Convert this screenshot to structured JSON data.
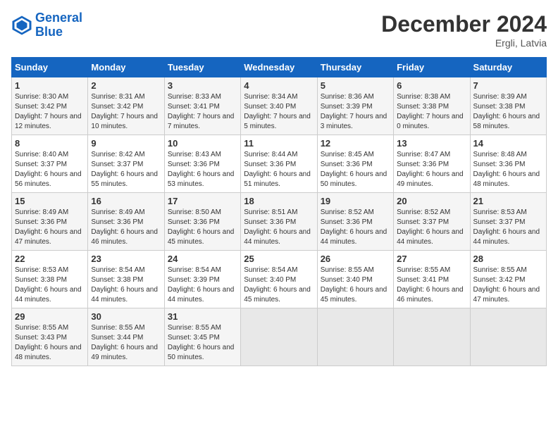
{
  "header": {
    "logo_line1": "General",
    "logo_line2": "Blue",
    "month": "December 2024",
    "location": "Ergli, Latvia"
  },
  "weekdays": [
    "Sunday",
    "Monday",
    "Tuesday",
    "Wednesday",
    "Thursday",
    "Friday",
    "Saturday"
  ],
  "weeks": [
    [
      {
        "day": "1",
        "sunrise": "Sunrise: 8:30 AM",
        "sunset": "Sunset: 3:42 PM",
        "daylight": "Daylight: 7 hours and 12 minutes."
      },
      {
        "day": "2",
        "sunrise": "Sunrise: 8:31 AM",
        "sunset": "Sunset: 3:42 PM",
        "daylight": "Daylight: 7 hours and 10 minutes."
      },
      {
        "day": "3",
        "sunrise": "Sunrise: 8:33 AM",
        "sunset": "Sunset: 3:41 PM",
        "daylight": "Daylight: 7 hours and 7 minutes."
      },
      {
        "day": "4",
        "sunrise": "Sunrise: 8:34 AM",
        "sunset": "Sunset: 3:40 PM",
        "daylight": "Daylight: 7 hours and 5 minutes."
      },
      {
        "day": "5",
        "sunrise": "Sunrise: 8:36 AM",
        "sunset": "Sunset: 3:39 PM",
        "daylight": "Daylight: 7 hours and 3 minutes."
      },
      {
        "day": "6",
        "sunrise": "Sunrise: 8:38 AM",
        "sunset": "Sunset: 3:38 PM",
        "daylight": "Daylight: 7 hours and 0 minutes."
      },
      {
        "day": "7",
        "sunrise": "Sunrise: 8:39 AM",
        "sunset": "Sunset: 3:38 PM",
        "daylight": "Daylight: 6 hours and 58 minutes."
      }
    ],
    [
      {
        "day": "8",
        "sunrise": "Sunrise: 8:40 AM",
        "sunset": "Sunset: 3:37 PM",
        "daylight": "Daylight: 6 hours and 56 minutes."
      },
      {
        "day": "9",
        "sunrise": "Sunrise: 8:42 AM",
        "sunset": "Sunset: 3:37 PM",
        "daylight": "Daylight: 6 hours and 55 minutes."
      },
      {
        "day": "10",
        "sunrise": "Sunrise: 8:43 AM",
        "sunset": "Sunset: 3:36 PM",
        "daylight": "Daylight: 6 hours and 53 minutes."
      },
      {
        "day": "11",
        "sunrise": "Sunrise: 8:44 AM",
        "sunset": "Sunset: 3:36 PM",
        "daylight": "Daylight: 6 hours and 51 minutes."
      },
      {
        "day": "12",
        "sunrise": "Sunrise: 8:45 AM",
        "sunset": "Sunset: 3:36 PM",
        "daylight": "Daylight: 6 hours and 50 minutes."
      },
      {
        "day": "13",
        "sunrise": "Sunrise: 8:47 AM",
        "sunset": "Sunset: 3:36 PM",
        "daylight": "Daylight: 6 hours and 49 minutes."
      },
      {
        "day": "14",
        "sunrise": "Sunrise: 8:48 AM",
        "sunset": "Sunset: 3:36 PM",
        "daylight": "Daylight: 6 hours and 48 minutes."
      }
    ],
    [
      {
        "day": "15",
        "sunrise": "Sunrise: 8:49 AM",
        "sunset": "Sunset: 3:36 PM",
        "daylight": "Daylight: 6 hours and 47 minutes."
      },
      {
        "day": "16",
        "sunrise": "Sunrise: 8:49 AM",
        "sunset": "Sunset: 3:36 PM",
        "daylight": "Daylight: 6 hours and 46 minutes."
      },
      {
        "day": "17",
        "sunrise": "Sunrise: 8:50 AM",
        "sunset": "Sunset: 3:36 PM",
        "daylight": "Daylight: 6 hours and 45 minutes."
      },
      {
        "day": "18",
        "sunrise": "Sunrise: 8:51 AM",
        "sunset": "Sunset: 3:36 PM",
        "daylight": "Daylight: 6 hours and 44 minutes."
      },
      {
        "day": "19",
        "sunrise": "Sunrise: 8:52 AM",
        "sunset": "Sunset: 3:36 PM",
        "daylight": "Daylight: 6 hours and 44 minutes."
      },
      {
        "day": "20",
        "sunrise": "Sunrise: 8:52 AM",
        "sunset": "Sunset: 3:37 PM",
        "daylight": "Daylight: 6 hours and 44 minutes."
      },
      {
        "day": "21",
        "sunrise": "Sunrise: 8:53 AM",
        "sunset": "Sunset: 3:37 PM",
        "daylight": "Daylight: 6 hours and 44 minutes."
      }
    ],
    [
      {
        "day": "22",
        "sunrise": "Sunrise: 8:53 AM",
        "sunset": "Sunset: 3:38 PM",
        "daylight": "Daylight: 6 hours and 44 minutes."
      },
      {
        "day": "23",
        "sunrise": "Sunrise: 8:54 AM",
        "sunset": "Sunset: 3:38 PM",
        "daylight": "Daylight: 6 hours and 44 minutes."
      },
      {
        "day": "24",
        "sunrise": "Sunrise: 8:54 AM",
        "sunset": "Sunset: 3:39 PM",
        "daylight": "Daylight: 6 hours and 44 minutes."
      },
      {
        "day": "25",
        "sunrise": "Sunrise: 8:54 AM",
        "sunset": "Sunset: 3:40 PM",
        "daylight": "Daylight: 6 hours and 45 minutes."
      },
      {
        "day": "26",
        "sunrise": "Sunrise: 8:55 AM",
        "sunset": "Sunset: 3:40 PM",
        "daylight": "Daylight: 6 hours and 45 minutes."
      },
      {
        "day": "27",
        "sunrise": "Sunrise: 8:55 AM",
        "sunset": "Sunset: 3:41 PM",
        "daylight": "Daylight: 6 hours and 46 minutes."
      },
      {
        "day": "28",
        "sunrise": "Sunrise: 8:55 AM",
        "sunset": "Sunset: 3:42 PM",
        "daylight": "Daylight: 6 hours and 47 minutes."
      }
    ],
    [
      {
        "day": "29",
        "sunrise": "Sunrise: 8:55 AM",
        "sunset": "Sunset: 3:43 PM",
        "daylight": "Daylight: 6 hours and 48 minutes."
      },
      {
        "day": "30",
        "sunrise": "Sunrise: 8:55 AM",
        "sunset": "Sunset: 3:44 PM",
        "daylight": "Daylight: 6 hours and 49 minutes."
      },
      {
        "day": "31",
        "sunrise": "Sunrise: 8:55 AM",
        "sunset": "Sunset: 3:45 PM",
        "daylight": "Daylight: 6 hours and 50 minutes."
      },
      null,
      null,
      null,
      null
    ]
  ]
}
